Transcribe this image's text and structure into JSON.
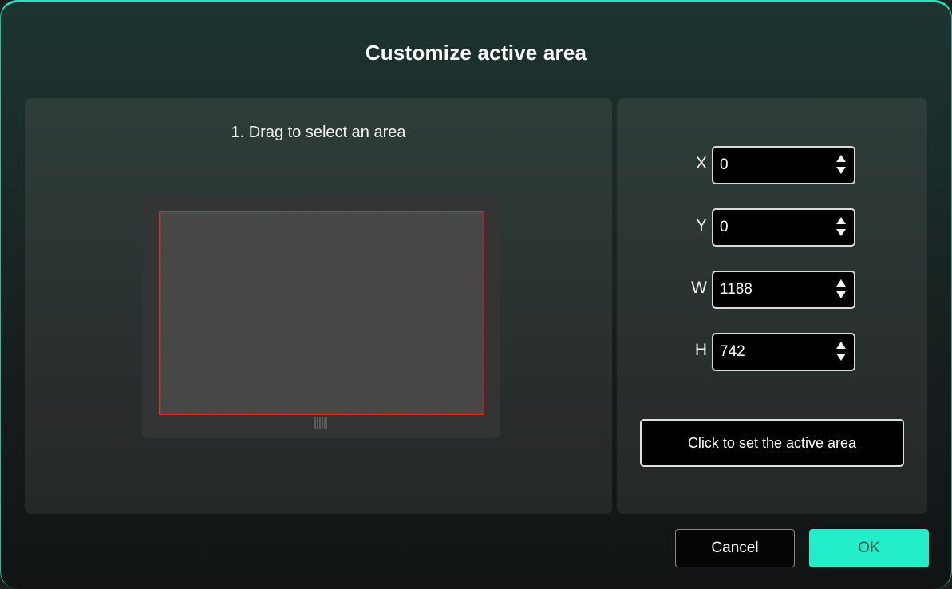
{
  "dialog": {
    "title": "Customize active area"
  },
  "left_panel": {
    "instruction": "1. Drag to select an area"
  },
  "fields": [
    {
      "label": "X",
      "value": "0"
    },
    {
      "label": "Y",
      "value": "0"
    },
    {
      "label": "W",
      "value": "1188"
    },
    {
      "label": "H",
      "value": "742"
    }
  ],
  "set_area_button": "Click to set the active area",
  "footer": {
    "cancel_label": "Cancel",
    "ok_label": "OK"
  },
  "colors": {
    "accent": "#23ecc8",
    "selection_border": "#e22a2a"
  },
  "icons": {
    "spin_up": "triangle-up-icon",
    "spin_down": "triangle-down-icon"
  }
}
